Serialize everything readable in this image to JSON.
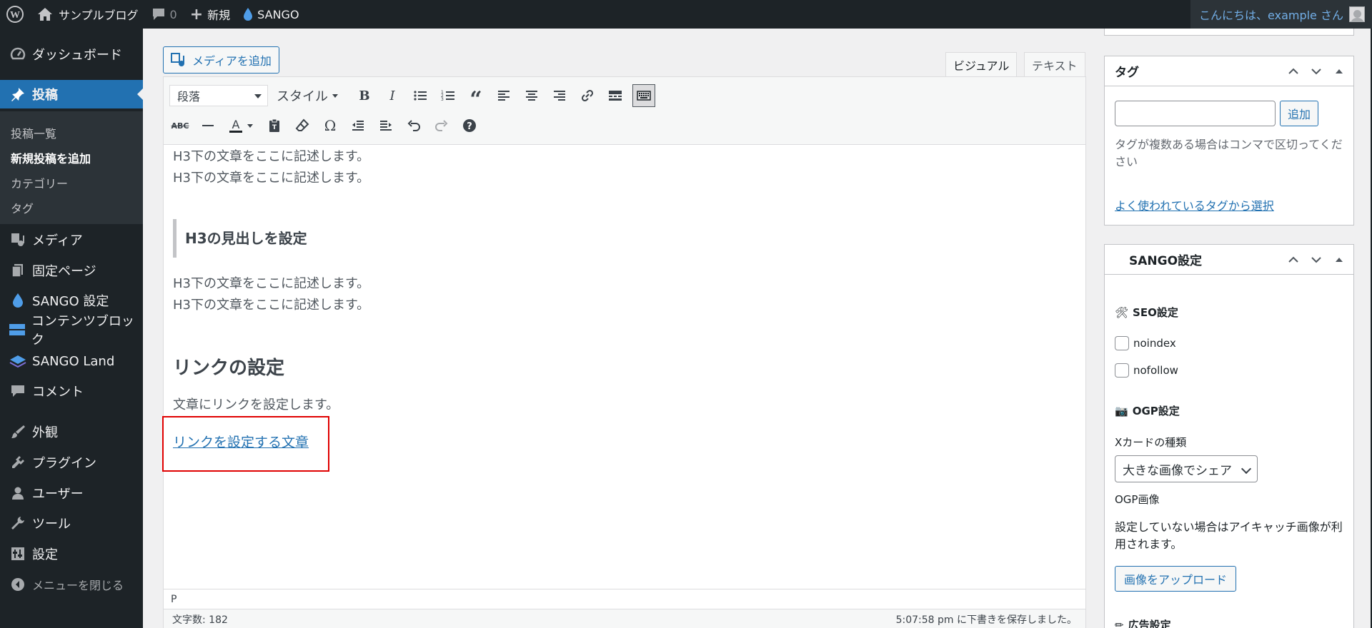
{
  "admin_bar": {
    "site_name": "サンプルブログ",
    "comments_count": "0",
    "new_label": "新規",
    "sango_label": "SANGO",
    "greeting": "こんにちは、example さん"
  },
  "sidebar": {
    "items": [
      {
        "label": "ダッシュボード",
        "icon": "dashboard-icon"
      },
      {
        "label": "投稿",
        "icon": "pin-icon"
      },
      {
        "label": "メディア",
        "icon": "media-icon"
      },
      {
        "label": "固定ページ",
        "icon": "page-icon"
      },
      {
        "label": "SANGO 設定",
        "icon": "drop-icon"
      },
      {
        "label": "コンテンツブロック",
        "icon": "blocks-icon"
      },
      {
        "label": "SANGO Land",
        "icon": "layers-icon"
      },
      {
        "label": "コメント",
        "icon": "comment-icon"
      },
      {
        "label": "外観",
        "icon": "brush-icon"
      },
      {
        "label": "プラグイン",
        "icon": "plugin-icon"
      },
      {
        "label": "ユーザー",
        "icon": "user-icon"
      },
      {
        "label": "ツール",
        "icon": "wrench-icon"
      },
      {
        "label": "設定",
        "icon": "settings-icon"
      }
    ],
    "submenu": [
      "投稿一覧",
      "新規投稿を追加",
      "カテゴリー",
      "タグ"
    ],
    "collapse_label": "メニューを閉じる"
  },
  "editor": {
    "add_media": "メディアを追加",
    "tab_visual": "ビジュアル",
    "tab_text": "テキスト",
    "format_select": "段落",
    "style_select": "スタイル",
    "content": {
      "p1": "H3下の文章をここに記述します。",
      "p2": "H3下の文章をここに記述します。",
      "h3": "H3の見出しを設定",
      "p3": "H3下の文章をここに記述します。",
      "p4": "H3下の文章をここに記述します。",
      "h2": "リンクの設定",
      "p5": "文章にリンクを設定します。",
      "link": "リンクを設定する文章"
    },
    "path": "P",
    "word_count": "文字数: 182",
    "autosave": "5:07:58 pm に下書きを保存しました。"
  },
  "tags_box": {
    "title": "タグ",
    "add_button": "追加",
    "hint": "タグが複数ある場合はコンマで区切ってください",
    "popular_link": "よく使われているタグから選択"
  },
  "sango_box": {
    "title": "SANGO設定",
    "seo_title": "SEO設定",
    "noindex": "noindex",
    "nofollow": "nofollow",
    "ogp_title": "OGP設定",
    "card_label": "Xカードの種類",
    "card_value": "大きな画像でシェア",
    "ogp_image_label": "OGP画像",
    "ogp_image_hint": "設定していない場合はアイキャッチ画像が利用されます。",
    "upload_button": "画像をアップロード",
    "ad_title": "広告設定"
  },
  "colors": {
    "admin_bar": "#1d2327",
    "accent": "#2271b1",
    "highlight_box": "#e00000"
  }
}
